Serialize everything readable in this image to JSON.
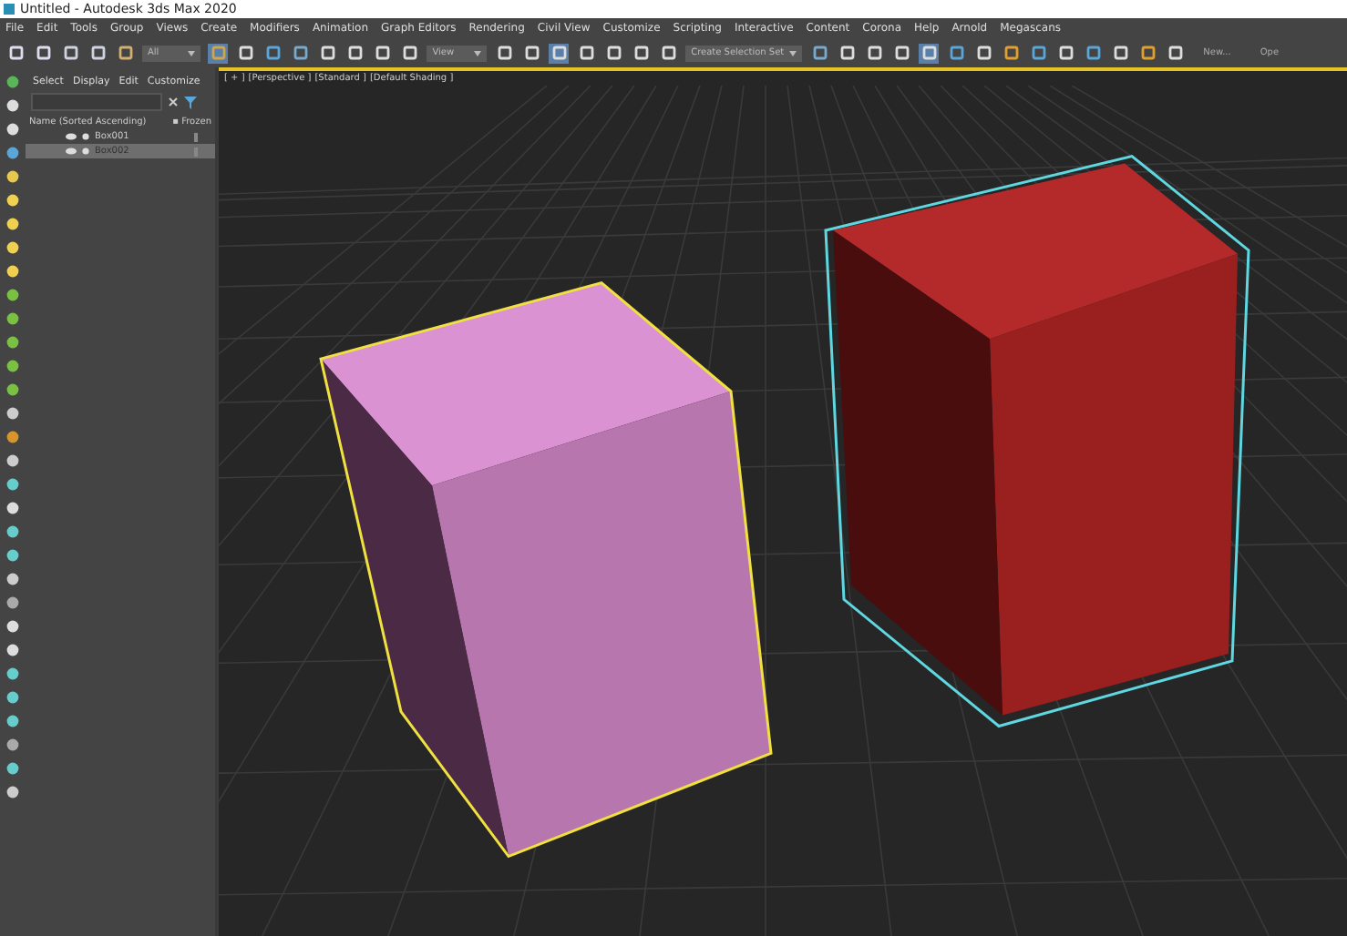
{
  "window": {
    "title": "Untitled - Autodesk 3ds Max 2020"
  },
  "menu": [
    "File",
    "Edit",
    "Tools",
    "Group",
    "Views",
    "Create",
    "Modifiers",
    "Animation",
    "Graph Editors",
    "Rendering",
    "Civil View",
    "Customize",
    "Scripting",
    "Interactive",
    "Content",
    "Corona",
    "Help",
    "Arnold",
    "Megascans"
  ],
  "toolbar": {
    "selection_filter": "All",
    "reference_coord": "View",
    "selection_set": "Create Selection Set",
    "buttons": [
      "New...",
      "Ope"
    ]
  },
  "scene_explorer": {
    "tabs": [
      "Select",
      "Display",
      "Edit",
      "Customize"
    ],
    "columns": [
      "Name (Sorted Ascending)",
      "▪ Frozen"
    ],
    "rows": [
      {
        "name": "Box001",
        "selected": false
      },
      {
        "name": "Box002",
        "selected": true
      }
    ]
  },
  "viewport": {
    "labels": [
      "[ + ]",
      "[Perspective ]",
      "[Standard ]",
      "[Default Shading ]"
    ]
  }
}
